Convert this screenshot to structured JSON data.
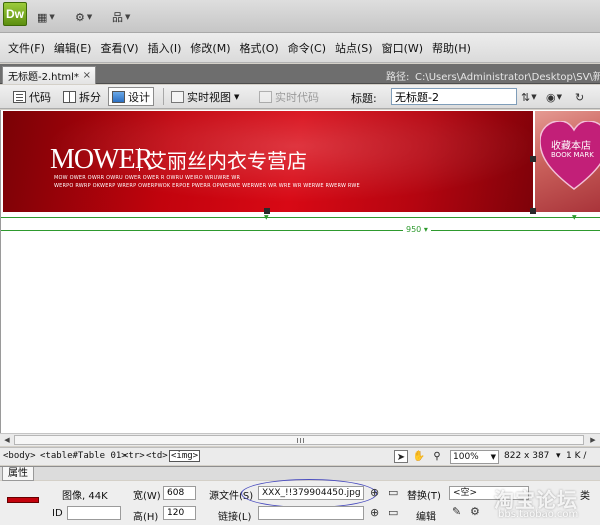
{
  "app": {
    "logo_text": "Dw"
  },
  "menu": [
    "文件(F)",
    "编辑(E)",
    "查看(V)",
    "插入(I)",
    "修改(M)",
    "格式(O)",
    "命令(C)",
    "站点(S)",
    "窗口(W)",
    "帮助(H)"
  ],
  "doc": {
    "tab_title": "无标题-2.html*",
    "tab_close": "×",
    "path_label": "路径:",
    "path_value": "C:\\Users\\Administrator\\Desktop\\SV\\新建"
  },
  "toolbar": {
    "code_label": "代码",
    "split_label": "拆分",
    "design_label": "设计",
    "live_view_label": "实时视图",
    "live_code_label": "实时代码",
    "title_label": "标题:",
    "title_value": "无标题-2"
  },
  "banner": {
    "brand": "MOWER",
    "store_name": "艾丽丝内衣专营店",
    "tagline_1": "MOW OWER OWRR OWRU OWER OWER R OWRU WEIRO WRUWRE WR",
    "tagline_2": "WERPO RWRP OKWERP WRERP OWERPWOK ERPOE PWERR OPWERWE WERWER WR WRE WR WERWE RWERW RWE",
    "favorite_text": "收藏本店",
    "favorite_sub": "BOOK MARK",
    "table_width": "950"
  },
  "status": {
    "tags": [
      "<body>",
      "<table#Table 01>",
      "<tr>",
      "<td>",
      "<img>"
    ],
    "zoom": "100%",
    "dimensions": "822 x 387",
    "file_info": "1 K /"
  },
  "properties": {
    "tab_label": "属性",
    "type_label": "图像, 44K",
    "width_label": "宽(W)",
    "width_value": "608",
    "height_label": "高(H)",
    "height_value": "120",
    "id_label": "ID",
    "id_value": "",
    "src_label": "源文件(S)",
    "src_value": "XXX_!!379904450.jpg",
    "link_label": "链接(L)",
    "link_value": "",
    "alt_label": "替换(T)",
    "alt_value": "<空>",
    "edit_label": "编辑",
    "class_label": "类"
  },
  "watermark": {
    "line1": "淘宝论坛",
    "line2": "bbs.taobao.com"
  },
  "colors": {
    "banner_red": "#c2030d",
    "guide_green": "#2e9a2e",
    "oval_blue": "#4c4fbf"
  }
}
